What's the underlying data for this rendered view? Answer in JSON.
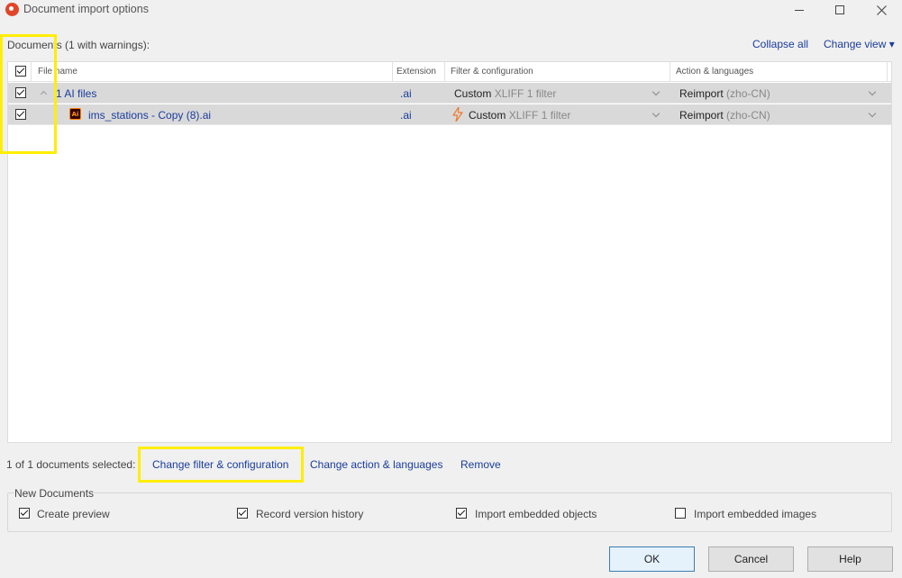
{
  "window": {
    "title": "Document import options",
    "minimize_icon": "minimize-icon",
    "maximize_icon": "maximize-icon",
    "close_icon": "close-icon"
  },
  "documents": {
    "header": "Documents (1 with warnings):",
    "collapse_all": "Collapse all",
    "change_view": "Change view ▾"
  },
  "grid": {
    "columns": [
      "File name",
      "Extension",
      "Filter & configuration",
      "Action & languages"
    ],
    "select_all_checked": true,
    "rows": [
      {
        "checked": true,
        "type": "group",
        "name": "1 AI files",
        "extension": ".ai",
        "filter_custom": "Custom",
        "filter_name": "XLIFF 1 filter",
        "action": "Reimport",
        "languages": "(zho-CN)"
      },
      {
        "checked": true,
        "type": "file",
        "icon": "adobe-illustrator-icon",
        "warning_icon": "lightning-warning-icon",
        "name": "ims_stations - Copy (8).ai",
        "extension": ".ai",
        "filter_custom": "Custom",
        "filter_name": "XLIFF 1 filter",
        "action": "Reimport",
        "languages": "(zho-CN)"
      }
    ]
  },
  "selection": {
    "status": "1 of 1 documents selected:",
    "change_filter": "Change filter & configuration",
    "change_action": "Change action & languages",
    "remove": "Remove"
  },
  "new_documents": {
    "legend": "New Documents",
    "options": [
      {
        "label": "Create preview",
        "checked": true
      },
      {
        "label": "Record version history",
        "checked": true
      },
      {
        "label": "Import embedded objects",
        "checked": true
      },
      {
        "label": "Import embedded images",
        "checked": false
      }
    ]
  },
  "buttons": {
    "ok": "OK",
    "cancel": "Cancel",
    "help": "Help"
  },
  "colors": {
    "link": "#1a3c9c",
    "highlight": "#ffee00",
    "row_selected": "#d9d9d9",
    "warning": "#f07a2a"
  }
}
